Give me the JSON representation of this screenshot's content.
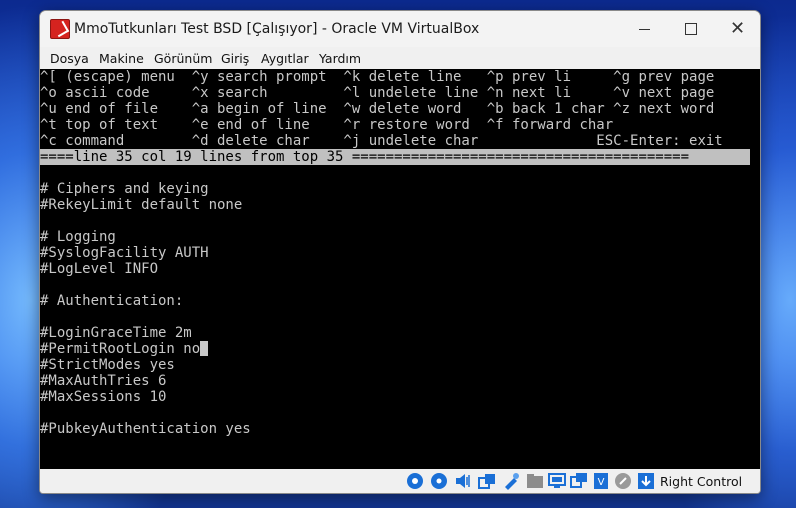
{
  "window": {
    "title": "MmoTutkunları Test BSD [Çalışıyor] - Oracle VM VirtualBox",
    "minimize_glyph": "",
    "close_glyph": "✕"
  },
  "menu": [
    "Dosya",
    "Makine",
    "Görünüm",
    "Giriş",
    "Aygıtlar",
    "Yardım"
  ],
  "editor": {
    "help_lines": [
      "^[ (escape) menu  ^y search prompt  ^k delete line   ^p prev li     ^g prev page",
      "^o ascii code     ^x search         ^l undelete line ^n next li     ^v next page",
      "^u end of file    ^a begin of line  ^w delete word   ^b back 1 char ^z next word",
      "^t top of text    ^e end of line    ^r restore word  ^f forward char",
      "^c command        ^d delete char    ^j undelete char              ESC-Enter: exit"
    ],
    "status_line": "====line 35 col 19 lines from top 35 ========================================",
    "content_lines": [
      "",
      "# Ciphers and keying",
      "#RekeyLimit default none",
      "",
      "# Logging",
      "#SyslogFacility AUTH",
      "#LogLevel INFO",
      "",
      "# Authentication:",
      "",
      "#LoginGraceTime 2m",
      "#PermitRootLogin no",
      "#StrictModes yes",
      "#MaxAuthTries 6",
      "#MaxSessions 10",
      "",
      "#PubkeyAuthentication yes"
    ],
    "cursor_line_index": 11
  },
  "statusbar": {
    "host_key_label": "Right Control",
    "icons": [
      "hard-disk-icon",
      "optical-drive-icon",
      "audio-icon",
      "network-icon",
      "usb-icon",
      "shared-folder-icon",
      "display-icon",
      "video-capture-icon",
      "vm-state-icon",
      "mouse-integration-icon",
      "keyboard-capture-icon"
    ]
  },
  "colors": {
    "terminal_bg": "#000000",
    "terminal_fg": "#c8c8c8",
    "status_bg": "#c0c0c0",
    "accent_blue": "#1a6fd6"
  }
}
